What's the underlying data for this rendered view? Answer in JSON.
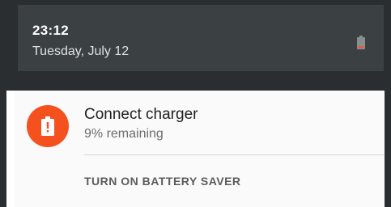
{
  "status_header": {
    "time": "23:12",
    "date": "Tuesday, July 12",
    "battery_icon": "battery-low-icon"
  },
  "notification": {
    "icon": "battery-alert-icon",
    "icon_color": "#f4511e",
    "title": "Connect charger",
    "subtitle": "9% remaining",
    "action_label": "TURN ON BATTERY SAVER"
  }
}
